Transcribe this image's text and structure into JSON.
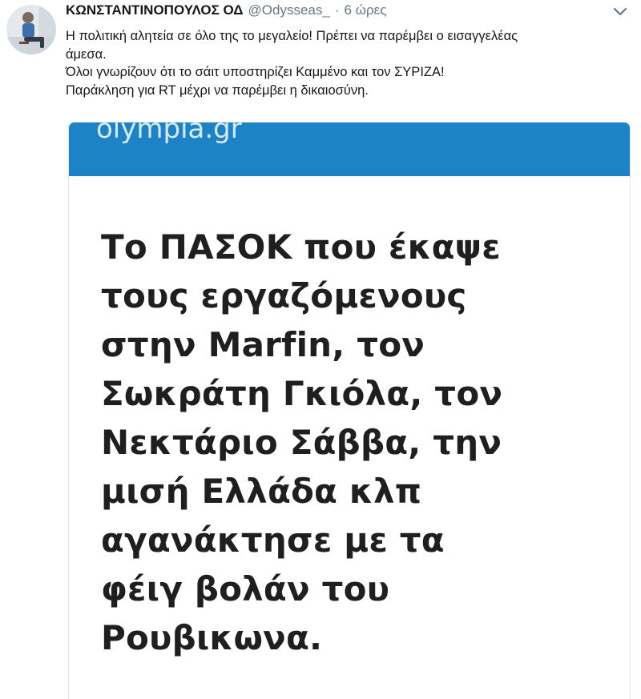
{
  "tweet": {
    "author": {
      "full_name": "ΚΩΝΣΤΑΝΤΙΝΟΠΟΥΛΟΣ ΟΔ",
      "handle": "@Odysseas_",
      "separator": "·",
      "time": "6 ώρες"
    },
    "text_lines": [
      "Η πολιτική αλητεία σε όλο της το μεγαλείο! Πρέπει να παρέμβει ο εισαγγελέας",
      "άμεσα.",
      "Όλοι γνωρίζουν ότι το σάιτ υποστηρίζει Καμμένο και τον ΣΥΡΙΖΑ!",
      "Παράκληση για RT μέχρι να παρέμβει η δικαιοσύνη."
    ],
    "menu_icon": "chevron-down-icon",
    "avatar_icon": "user-photo"
  },
  "card": {
    "site_name": "olympia.gr",
    "banner_color": "#1b83c6",
    "headline_lines": [
      "Το ΠΑΣΟΚ που έκαψε",
      "τους εργαζόμενους",
      "στην Marfin, τον",
      "Σωκράτη Γκιόλα, τον",
      "Νεκτάριο Σάββα, την",
      "μισή Ελλάδα κλπ",
      "αγανάκτησε με τα",
      "φέιγ βολάν του",
      "Ρουβικωνα."
    ]
  }
}
